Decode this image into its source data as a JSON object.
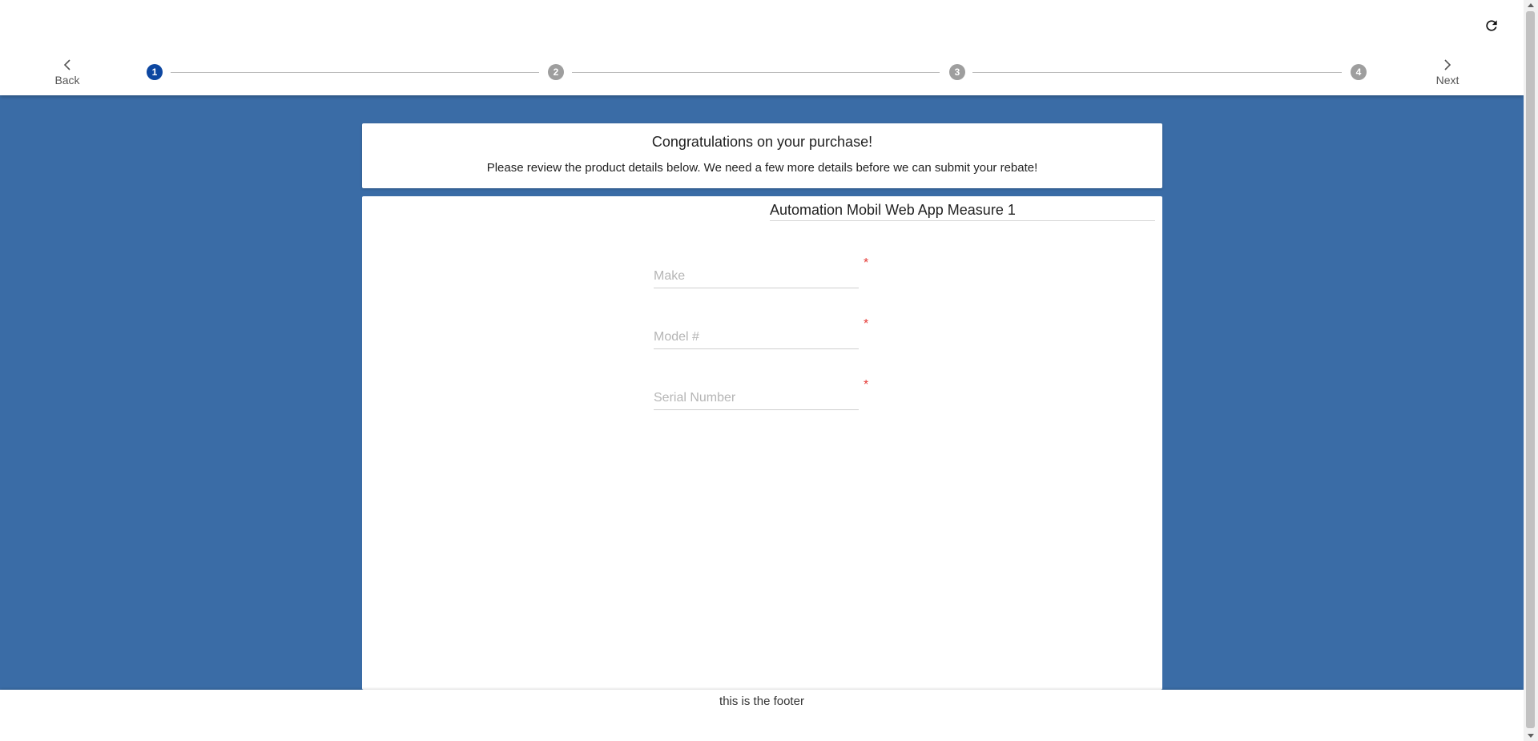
{
  "nav": {
    "back_label": "Back",
    "next_label": "Next",
    "steps": [
      "1",
      "2",
      "3",
      "4"
    ],
    "active_step": 1
  },
  "header": {
    "title": "Congratulations on your purchase!",
    "subtitle": "Please review the product details below. We need a few more details before we can submit your rebate!"
  },
  "product": {
    "title": "Automation Mobil Web App Measure 1"
  },
  "form": {
    "make_placeholder": "Make",
    "make_value": "",
    "model_placeholder": "Model #",
    "model_value": "",
    "serial_placeholder": "Serial Number",
    "serial_value": "",
    "required_marker": "*"
  },
  "footer": {
    "text": "this is the footer"
  },
  "colors": {
    "background": "#3a6ca6",
    "active_step": "#0d47a1",
    "inactive_step": "#9e9e9e",
    "required": "#e53935"
  },
  "icons": {
    "refresh": "refresh-icon",
    "back": "chevron-left-icon",
    "next": "chevron-right-icon"
  }
}
